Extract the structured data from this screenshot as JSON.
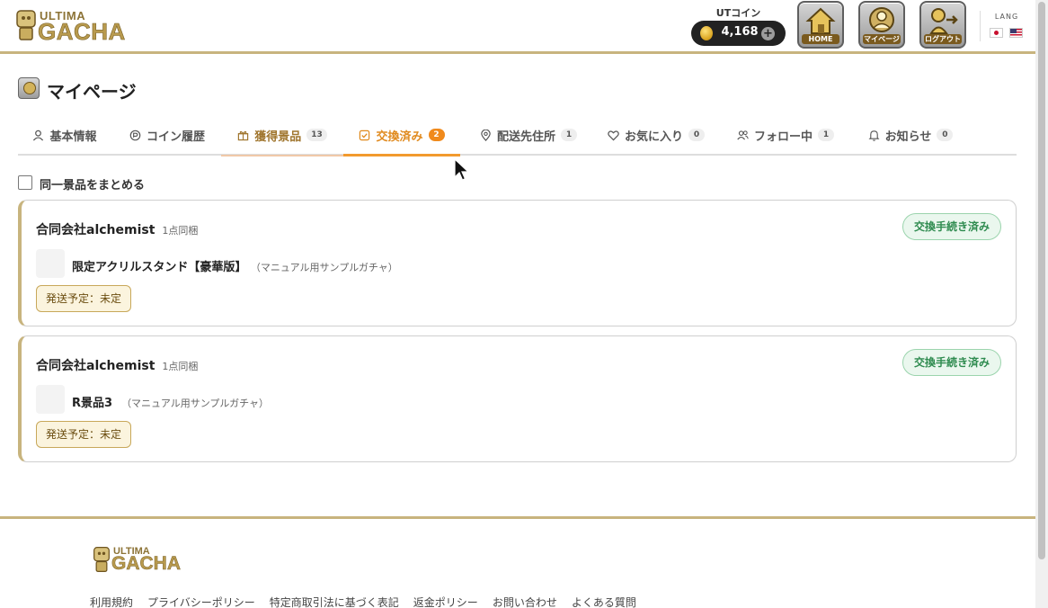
{
  "header": {
    "logo_top": "ULTIMA",
    "logo_bottom": "GACHA",
    "coin_label": "UTコイン",
    "coin_amount": "4,168",
    "coin_plus": "+",
    "nav": [
      {
        "label": "HOME",
        "icon": "home-icon"
      },
      {
        "label": "マイページ",
        "icon": "mypage-icon"
      },
      {
        "label": "ログアウト",
        "icon": "logout-icon"
      }
    ],
    "lang_label": "LANG"
  },
  "page": {
    "title": "マイページ"
  },
  "tabs": [
    {
      "label": "基本情報",
      "icon": "person-icon",
      "count": ""
    },
    {
      "label": "コイン履歴",
      "icon": "coin-icon",
      "count": ""
    },
    {
      "label": "獲得景品",
      "icon": "gift-icon",
      "count": "13"
    },
    {
      "label": "交換済み",
      "icon": "check-square-icon",
      "count": "2",
      "active": true
    },
    {
      "label": "配送先住所",
      "icon": "map-pin-icon",
      "count": "1"
    },
    {
      "label": "お気に入り",
      "icon": "heart-icon",
      "count": "0"
    },
    {
      "label": "フォロー中",
      "icon": "users-icon",
      "count": "1"
    },
    {
      "label": "お知らせ",
      "icon": "bell-icon",
      "count": "0"
    }
  ],
  "merge_label": "同一景品をまとめる",
  "cards": [
    {
      "company": "合同会社alchemist",
      "bundle": "1点同梱",
      "status": "交換手続き済み",
      "prize": "限定アクリルスタンド【豪華版】",
      "source": "（マニュアル用サンプルガチャ）",
      "shipping": "発送予定：未定"
    },
    {
      "company": "合同会社alchemist",
      "bundle": "1点同梱",
      "status": "交換手続き済み",
      "prize": "R景品3",
      "source": "（マニュアル用サンプルガチャ）",
      "shipping": "発送予定：未定"
    }
  ],
  "footer": {
    "logo_top": "ULTIMA",
    "logo_bottom": "GACHA",
    "links": [
      "利用規約",
      "プライバシーポリシー",
      "特定商取引法に基づく表記",
      "返金ポリシー",
      "お問い合わせ",
      "よくある質問"
    ]
  },
  "colors": {
    "accent_gold": "#c8b47e",
    "active_tab": "#f29a2e",
    "status_green": "#2e8b4f"
  }
}
